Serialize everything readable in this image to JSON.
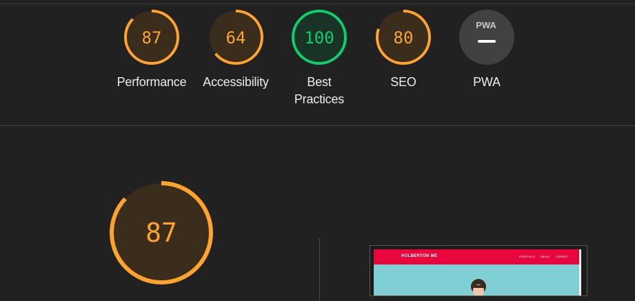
{
  "categories": [
    {
      "label": "Performance",
      "score": 87,
      "score_text": "87",
      "color": "#ffa32c",
      "fill": "#3a2d1c"
    },
    {
      "label": "Accessibility",
      "score": 64,
      "score_text": "64",
      "color": "#ffa32c",
      "fill": "#3a2d1c"
    },
    {
      "label": "Best Practices",
      "score": 100,
      "score_text": "100",
      "color": "#0cce6b",
      "fill": "#193326"
    },
    {
      "label": "SEO",
      "score": 80,
      "score_text": "80",
      "color": "#ffa32c",
      "fill": "#3a2d1c"
    },
    {
      "label": "PWA",
      "score_text": "",
      "badge": "PWA",
      "color": "#9e9e9e",
      "fill": "#414141"
    }
  ],
  "summary": {
    "score": 87,
    "score_text": "87",
    "color": "#ffa32c"
  },
  "screenshot": {
    "brand": "HOLBERTON ME",
    "nav_links": [
      "PORTFOLIO",
      "ABOUT",
      "CONTACT"
    ]
  }
}
